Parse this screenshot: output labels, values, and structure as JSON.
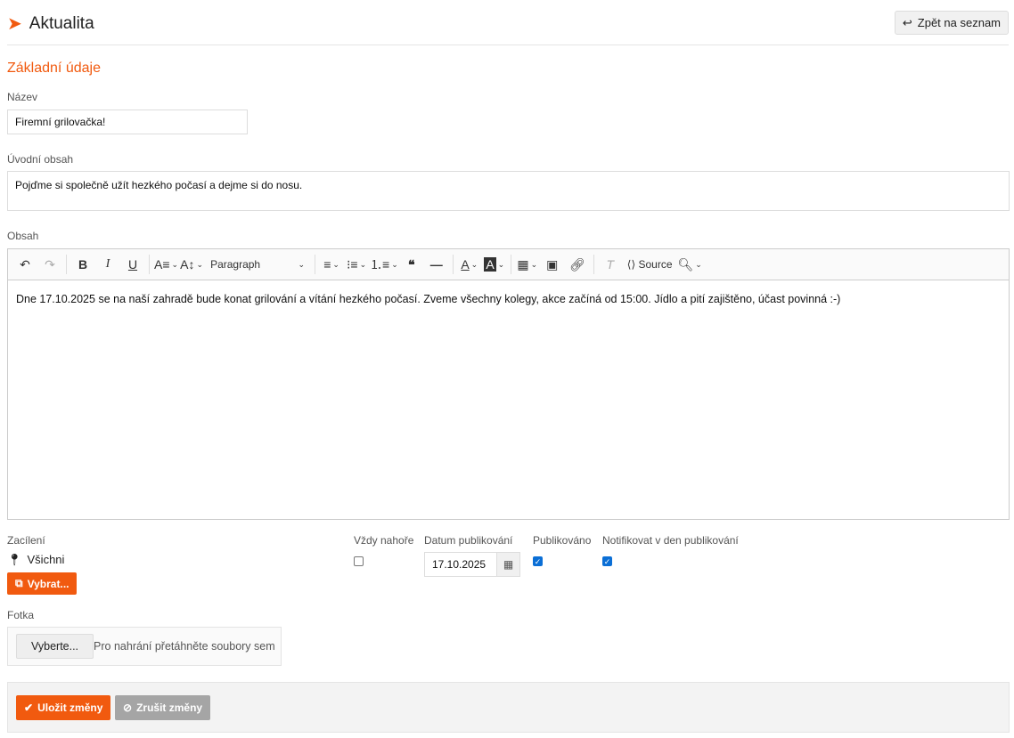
{
  "header": {
    "title": "Aktualita",
    "back_label": "Zpět na seznam"
  },
  "section_title": "Základní údaje",
  "name": {
    "label": "Název",
    "value": "Firemní grilovačka!"
  },
  "intro": {
    "label": "Úvodní obsah",
    "value": "Pojďme si společně užít hezkého počasí a dejme si do nosu."
  },
  "content": {
    "label": "Obsah",
    "format": "Paragraph",
    "source_label": "Source",
    "text": "Dne 17.10.2025 se na naší zahradě bude konat grilování a vítání hezkého počasí. Zveme všechny kolegy, akce začíná od 15:00. Jídlo a pití zajištěno, účast povinná :-)"
  },
  "targeting": {
    "label": "Zacílení",
    "value": "Všichni",
    "button": "Vybrat..."
  },
  "always_top": {
    "label": "Vždy nahoře",
    "checked": false
  },
  "publish_date": {
    "label": "Datum publikování",
    "value": "17.10.2025"
  },
  "published": {
    "label": "Publikováno",
    "checked": true
  },
  "notify": {
    "label": "Notifikovat v den publikování",
    "checked": true
  },
  "photo": {
    "label": "Fotka",
    "button": "Vyberte...",
    "hint": "Pro nahrání přetáhněte soubory sem"
  },
  "footer": {
    "save": "Uložit změny",
    "cancel": "Zrušit změny"
  },
  "colors": {
    "accent": "#f15a0f"
  }
}
